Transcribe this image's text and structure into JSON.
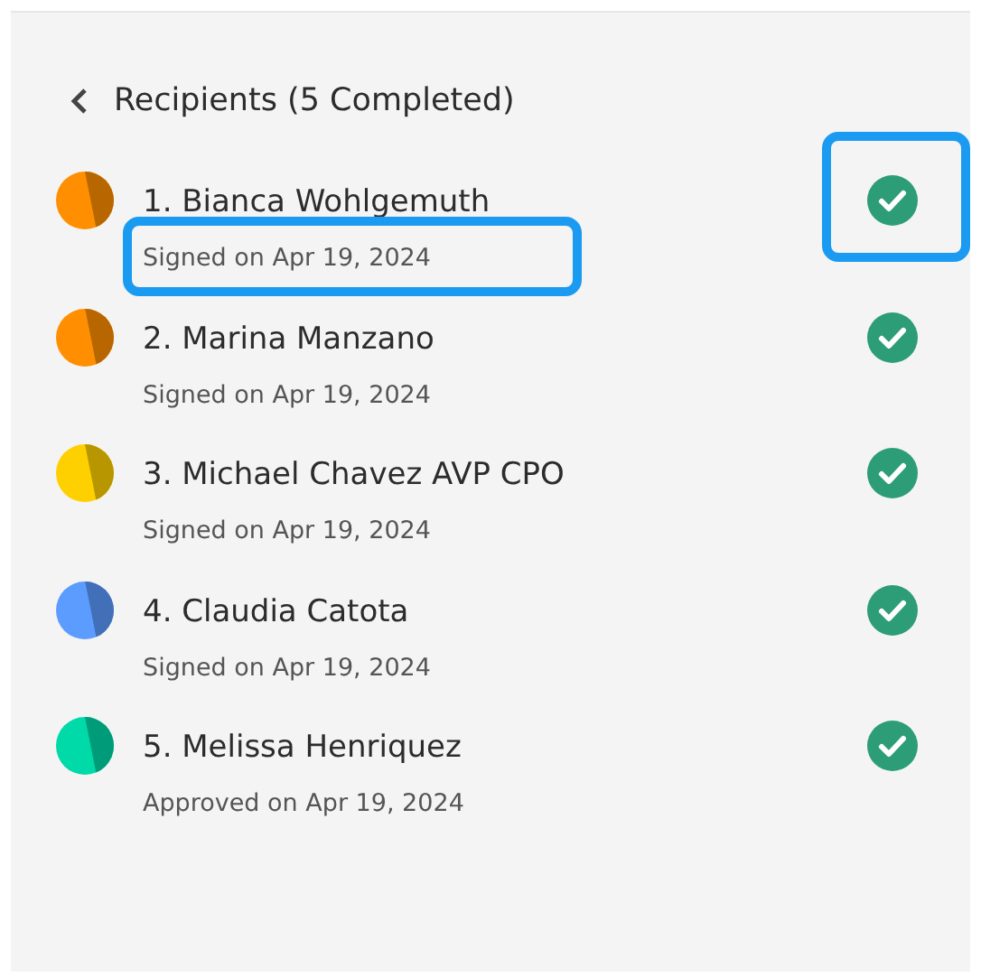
{
  "header": {
    "title": "Recipients (5 Completed)"
  },
  "recipients": [
    {
      "name": "1. Bianca Wohlgemuth",
      "status": "Signed on Apr 19, 2024",
      "color": "#ff8f00",
      "completed": true,
      "highlighted": true
    },
    {
      "name": "2. Marina Manzano",
      "status": "Signed on Apr 19, 2024",
      "color": "#ff8f00",
      "completed": true,
      "highlighted": false
    },
    {
      "name": "3. Michael Chavez AVP CPO",
      "status": "Signed on Apr 19, 2024",
      "color": "#ffd000",
      "completed": true,
      "highlighted": false
    },
    {
      "name": "4. Claudia Catota",
      "status": "Signed on Apr 19, 2024",
      "color": "#5c9cff",
      "completed": true,
      "highlighted": false
    },
    {
      "name": "5. Melissa Henriquez",
      "status": "Approved on Apr 19, 2024",
      "color": "#00d9a8",
      "completed": true,
      "highlighted": false
    }
  ]
}
